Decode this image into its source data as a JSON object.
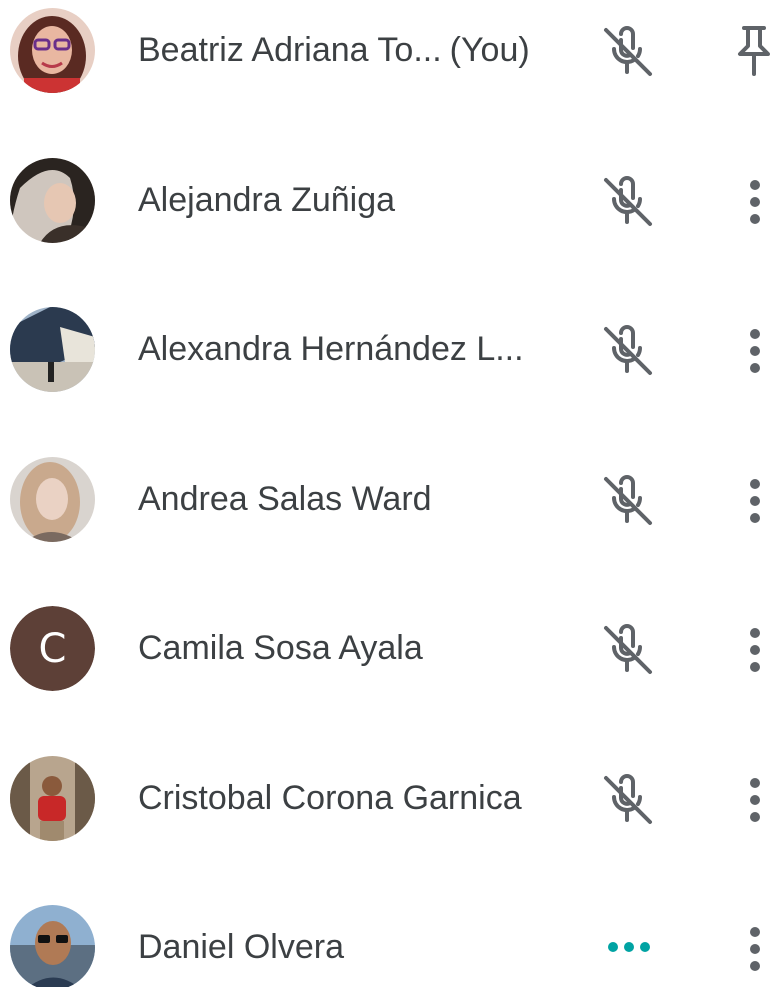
{
  "participants": [
    {
      "name": "Beatriz Adriana To...",
      "you_label": "(You)",
      "avatar": "photo-woman-glasses-red",
      "status_icon": "mic-off-icon",
      "action_icon": "pin-icon"
    },
    {
      "name": "Alejandra Zuñiga",
      "avatar": "photo-woman-dark-hair",
      "status_icon": "mic-off-icon",
      "action_icon": "more-vert-icon"
    },
    {
      "name": "Alexandra Hernández L...",
      "avatar": "photo-building-outdoor",
      "status_icon": "mic-off-icon",
      "action_icon": "more-vert-icon"
    },
    {
      "name": "Andrea Salas Ward",
      "avatar": "photo-woman-light-hair",
      "status_icon": "mic-off-icon",
      "action_icon": "more-vert-icon"
    },
    {
      "name": "Camila Sosa Ayala",
      "avatar_letter": "C",
      "avatar": "letter-avatar",
      "status_icon": "mic-off-icon",
      "action_icon": "more-vert-icon"
    },
    {
      "name": "Cristobal Corona Garnica",
      "avatar": "photo-man-red-shirt",
      "status_icon": "mic-off-icon",
      "action_icon": "more-vert-icon"
    },
    {
      "name": "Daniel Olvera",
      "avatar": "photo-man-sunglasses",
      "status_icon": "speaking-dots-icon",
      "action_icon": "more-vert-icon"
    }
  ],
  "colors": {
    "text": "#3c4043",
    "icon": "#5f6368",
    "speaking": "#00a3a3",
    "letter_avatar_bg": "#5d4037"
  }
}
